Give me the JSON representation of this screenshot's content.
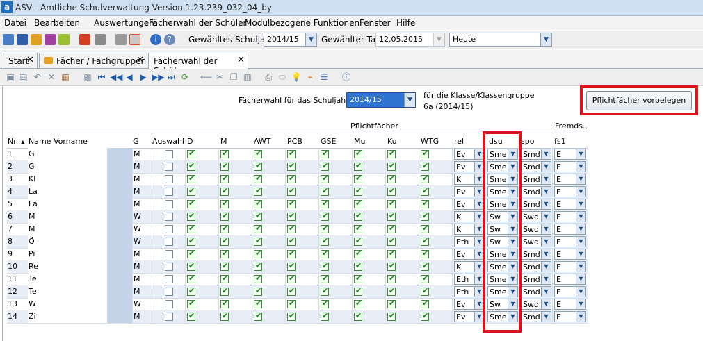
{
  "window": {
    "app_icon": "a",
    "title": "ASV - Amtliche Schulverwaltung Version 1.23.239_032_04_by"
  },
  "menu": [
    "Datei",
    "Bearbeiten",
    "Auswertungen",
    "Fächerwahl der Schüler",
    "Modulbezogene Funktionen",
    "Fenster",
    "Hilfe"
  ],
  "toolbar": {
    "schuljahr_label": "Gewähltes Schuljahr",
    "schuljahr_value": "2014/15",
    "tag_label": "Gewählter Tag",
    "tag_value": "12.05.2015",
    "heute_value": "Heute"
  },
  "tabs": [
    "Start",
    "Fächer / Fachgruppen",
    "Fächerwahl der Schüler"
  ],
  "form": {
    "schuljahr_label": "Fächerwahl für das Schuljahr",
    "schuljahr_value": "2014/15",
    "klasse_label": "für die Klasse/Klassengruppe",
    "klasse_value": "6a (2014/15)",
    "pflicht_button": "Pflichtfächer vorbelegen"
  },
  "table": {
    "group_pflicht": "Pflichtfächer",
    "group_fremd": "Fremds..",
    "columns": {
      "nr": "Nr.",
      "name": "Name Vorname",
      "g": "G",
      "auswahl": "Auswahl",
      "d": "D",
      "m": "M",
      "awt": "AWT",
      "pcb": "PCB",
      "gse": "GSE",
      "mu": "Mu",
      "ku": "Ku",
      "wtg": "WTG",
      "rel": "rel",
      "dsu": "dsu",
      "spo": "spo",
      "fs1": "fs1"
    },
    "rows": [
      {
        "nr": "1",
        "name": "G",
        "g": "M",
        "rel": "Ev",
        "dsu": "Sme",
        "spo": "Smd",
        "fs1": "E"
      },
      {
        "nr": "2",
        "name": "G",
        "g": "M",
        "rel": "Ev",
        "dsu": "Sme",
        "spo": "Smd",
        "fs1": "E"
      },
      {
        "nr": "3",
        "name": "Kl",
        "g": "M",
        "rel": "K",
        "dsu": "Sme",
        "spo": "Smd",
        "fs1": "E"
      },
      {
        "nr": "4",
        "name": "La",
        "g": "M",
        "rel": "Ev",
        "dsu": "Sme",
        "spo": "Smd",
        "fs1": "E"
      },
      {
        "nr": "5",
        "name": "La",
        "g": "M",
        "rel": "Ev",
        "dsu": "Sme",
        "spo": "Smd",
        "fs1": "E"
      },
      {
        "nr": "6",
        "name": "M",
        "g": "W",
        "rel": "K",
        "dsu": "Sw",
        "spo": "Swd",
        "fs1": "E"
      },
      {
        "nr": "7",
        "name": "M",
        "g": "W",
        "rel": "K",
        "dsu": "Sw",
        "spo": "Swd",
        "fs1": "E"
      },
      {
        "nr": "8",
        "name": "Ö",
        "g": "W",
        "rel": "Eth",
        "dsu": "Sw",
        "spo": "Swd",
        "fs1": "E"
      },
      {
        "nr": "9",
        "name": "Pi",
        "g": "M",
        "rel": "Ev",
        "dsu": "Sme",
        "spo": "Smd",
        "fs1": "E"
      },
      {
        "nr": "10",
        "name": "Re",
        "g": "M",
        "rel": "K",
        "dsu": "Sme",
        "spo": "Smd",
        "fs1": "E"
      },
      {
        "nr": "11",
        "name": "Te",
        "g": "M",
        "rel": "Eth",
        "dsu": "Sme",
        "spo": "Smd",
        "fs1": "E"
      },
      {
        "nr": "12",
        "name": "Te",
        "g": "M",
        "rel": "Eth",
        "dsu": "Sme",
        "spo": "Smd",
        "fs1": "E"
      },
      {
        "nr": "13",
        "name": "W",
        "g": "W",
        "rel": "Ev",
        "dsu": "Sw",
        "spo": "Swd",
        "fs1": "E"
      },
      {
        "nr": "14",
        "name": "Zi",
        "g": "M",
        "rel": "Ev",
        "dsu": "Sme",
        "spo": "Smd",
        "fs1": "E"
      }
    ]
  },
  "colors": {
    "highlight": "#e0101c",
    "row_alt": "#e8eef8",
    "accent": "#1f6fc5"
  }
}
